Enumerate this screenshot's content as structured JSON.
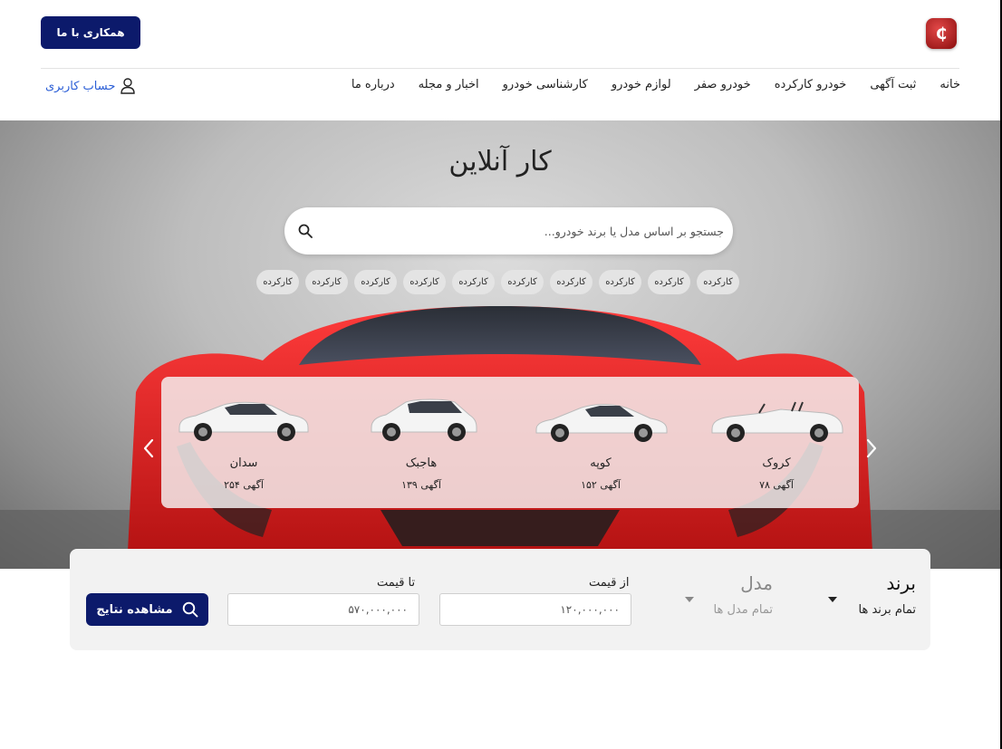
{
  "header": {
    "logo_glyph": "₵",
    "cooperate_button": "همکاری با ما",
    "account_link": "حساب کاربری",
    "nav": [
      "خانه",
      "ثبت آگهی",
      "خودرو کارکرده",
      "خودرو صفر",
      "لوازم خودرو",
      "کارشناسی خودرو",
      "اخبار و مجله",
      "درباره ما"
    ]
  },
  "hero": {
    "title": "کار آنلاین",
    "search_placeholder": "جستجو بر اساس مدل یا برند خودرو...",
    "chips": [
      "کارکرده",
      "کارکرده",
      "کارکرده",
      "کارکرده",
      "کارکرده",
      "کارکرده",
      "کارکرده",
      "کارکرده",
      "کارکرده",
      "کارکرده"
    ]
  },
  "body_types": [
    {
      "name": "سدان",
      "count": "۲۵۴ آگهی",
      "icon": "sedan-car"
    },
    {
      "name": "هاجبک",
      "count": "۱۳۹ آگهی",
      "icon": "hatchback-car"
    },
    {
      "name": "کوپه",
      "count": "۱۵۲ آگهی",
      "icon": "coupe-car"
    },
    {
      "name": "کروک",
      "count": "۷۸ آگهی",
      "icon": "convertible-car"
    }
  ],
  "filter": {
    "brand_title": "برند",
    "brand_value": "تمام برند ها",
    "model_title": "مدل",
    "model_value": "تمام مدل ها",
    "price_from_label": "از قیمت",
    "price_from_value": "۱۲۰,۰۰۰,۰۰۰",
    "price_to_label": "تا قیمت",
    "price_to_value": "۵۷۰,۰۰۰,۰۰۰",
    "submit_label": "مشاهده نتایج"
  },
  "colors": {
    "primary": "#0c1a6b",
    "link": "#2c5fd6",
    "hero_car": "#d81f1f"
  }
}
